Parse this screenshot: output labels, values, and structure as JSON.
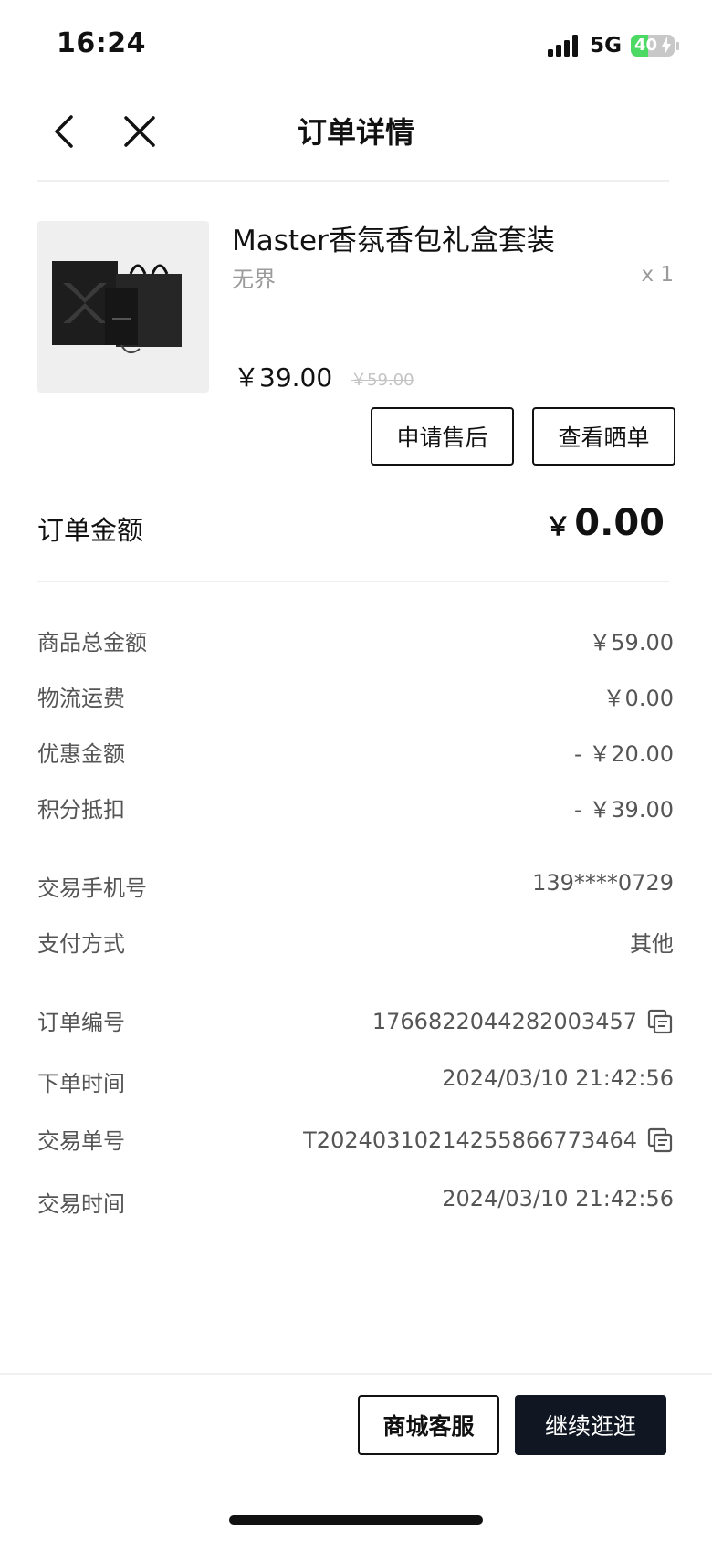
{
  "status_bar": {
    "time": "16:24",
    "network": "5G",
    "battery": "40",
    "battery_level": 0.4,
    "battery_color": "#4cd964"
  },
  "nav": {
    "title": "订单详情",
    "back_icon": "chevron-left-icon",
    "close_icon": "close-icon"
  },
  "product": {
    "name": "Master香氛香包礼盒套装",
    "shop": "无界",
    "quantity": "x 1",
    "price": "￥39.00",
    "original_price": "￥59.00"
  },
  "actions": {
    "after_sale": "申请售后",
    "view_review": "查看晒单"
  },
  "order_amount": {
    "label": "订单金额",
    "symbol": "￥",
    "value": "0.00"
  },
  "cost_rows": [
    {
      "label": "商品总金额",
      "value": "￥59.00"
    },
    {
      "label": "物流运费",
      "value": "￥0.00"
    },
    {
      "label": "优惠金额",
      "value": "- ￥20.00"
    },
    {
      "label": "积分抵扣",
      "value": "- ￥39.00"
    }
  ],
  "payment_rows": [
    {
      "label": "交易手机号",
      "value": "139****0729"
    },
    {
      "label": "支付方式",
      "value": "其他"
    }
  ],
  "order_rows": [
    {
      "label": "订单编号",
      "value": "1766822044282003457",
      "copyable": true
    },
    {
      "label": "下单时间",
      "value": "2024/03/10 21:42:56",
      "copyable": false
    },
    {
      "label": "交易单号",
      "value": "T20240310214255866773464",
      "copyable": true
    },
    {
      "label": "交易时间",
      "value": "2024/03/10 21:42:56",
      "copyable": false
    }
  ],
  "bottom": {
    "service": "商城客服",
    "continue": "继续逛逛",
    "continue_color": "#111722"
  }
}
